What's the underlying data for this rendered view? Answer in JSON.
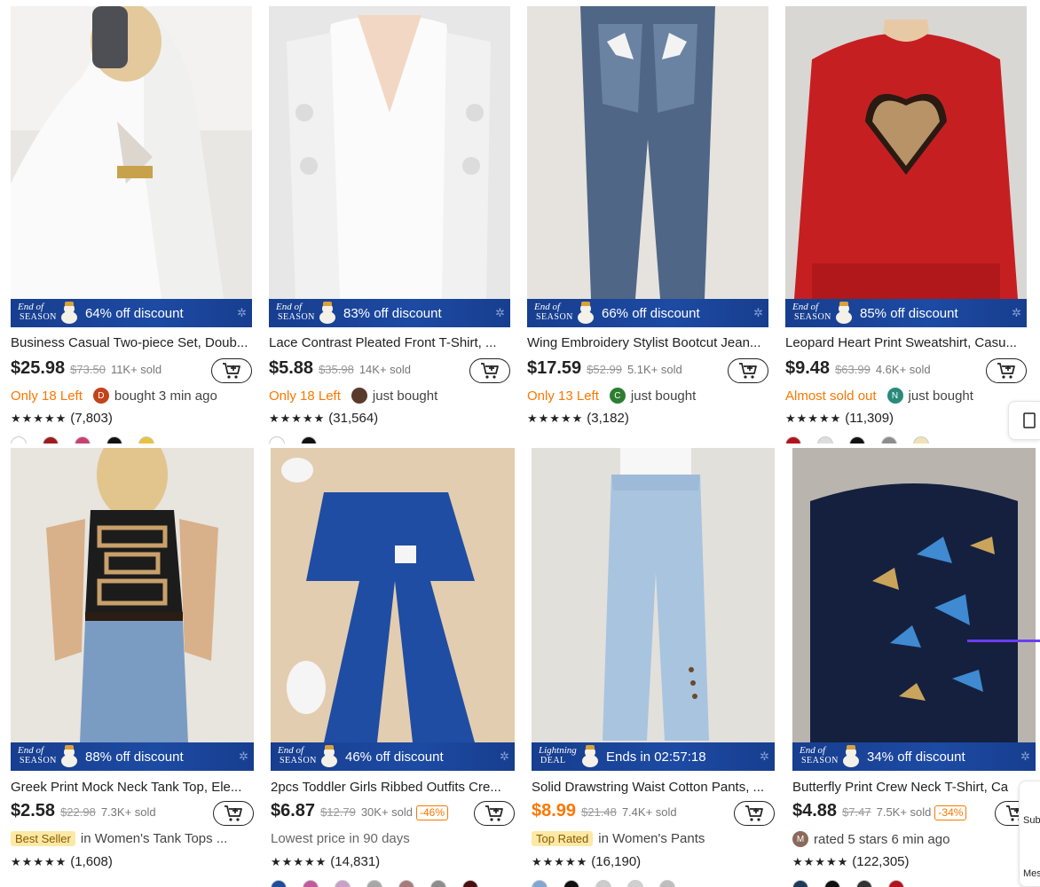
{
  "colors": {
    "accent_orange": "#fb7701",
    "banner_blue": "#1d4aa3",
    "tag_yellow": "#fde9a5",
    "side_bar_purple": "#6b3df2"
  },
  "banner_season": {
    "line1": "End of",
    "line2": "SEASON"
  },
  "banner_lightning": {
    "line1": "Lightning",
    "line2": "DEAL"
  },
  "cart_icon": "add-to-cart-icon",
  "products": [
    {
      "banner": "64% off discount",
      "title": "Business Casual Two-piece Set, Doub...",
      "price": "$25.98",
      "old_price": "$73.50",
      "sold": "11K+ sold",
      "stock": "Only 18 Left",
      "avatar_letter": "D",
      "avatar_color": "#c1441a",
      "social": "bought 3 min ago",
      "rating_stars": "★★★★★",
      "rating_count": "(7,803)",
      "swatches": [
        "#ffffff",
        "#a01b1b",
        "#c9406d",
        "#111111",
        "#e9c23b"
      ]
    },
    {
      "banner": "83% off discount",
      "title": "Lace Contrast Pleated Front T-Shirt, ...",
      "price": "$5.88",
      "old_price": "$35.98",
      "sold": "14K+ sold",
      "stock": "Only 18 Left",
      "avatar_letter": "",
      "avatar_color": "#5a3a2a",
      "social": "just bought",
      "rating_stars": "★★★★★",
      "rating_count": "(31,564)",
      "swatches": [
        "#ffffff",
        "#111111"
      ]
    },
    {
      "banner": "66% off discount",
      "title": "Wing Embroidery Stylist Bootcut Jean...",
      "price": "$17.59",
      "old_price": "$52.99",
      "sold": "5.1K+ sold",
      "stock": "Only 13 Left",
      "avatar_letter": "C",
      "avatar_color": "#2e7d32",
      "social": "just bought",
      "rating_stars": "★★★★★",
      "rating_count": "(3,182)",
      "swatches": []
    },
    {
      "banner": "85% off discount",
      "title": "Leopard Heart Print Sweatshirt, Casu...",
      "price": "$9.48",
      "old_price": "$63.99",
      "sold": "4.6K+ sold",
      "stock": "Almost sold out",
      "avatar_letter": "N",
      "avatar_color": "#2a8a7a",
      "social": "just bought",
      "rating_stars": "★★★★★",
      "rating_count": "(11,309)",
      "swatches": [
        "#b3141b",
        "#dddddd",
        "#111111",
        "#8d8d8d",
        "#f0e2b5"
      ]
    },
    {
      "banner": "88% off discount",
      "title": "Greek Print Mock Neck Tank Top, Ele...",
      "price": "$2.58",
      "old_price": "$22.98",
      "sold": "7.3K+ sold",
      "tag": "Best Seller",
      "tag_context": "in Women's Tank Tops ...",
      "rating_stars": "★★★★★",
      "rating_count": "(1,608)",
      "swatches": []
    },
    {
      "banner": "46% off discount",
      "title": "2pcs Toddler Girls Ribbed Outfits Cre...",
      "price": "$6.87",
      "old_price": "$12.79",
      "sold": "30K+ sold",
      "pct": "-46%",
      "note": "Lowest price in 90 days",
      "rating_stars": "★★★★★",
      "rating_count": "(14,831)",
      "swatches": [
        "#1d4e9b",
        "#c05a9a",
        "#c6a0c8",
        "#a7a7a7",
        "#a77b7b",
        "#8d8d8d",
        "#4a1010"
      ]
    },
    {
      "banner": "Ends in 02:57:18",
      "lightning": true,
      "title": "Solid Drawstring Waist Cotton Pants, ...",
      "price": "$8.99",
      "old_price": "$21.48",
      "sold": "7.4K+ sold",
      "orange_price": true,
      "tag": "Top Rated",
      "tag_context": "in Women's Pants",
      "rating_stars": "★★★★★",
      "rating_count": "(16,190)",
      "swatches": [
        "#7fa7d3",
        "#111111",
        "#cccccc",
        "#d0d0d0",
        "#bdbdbd"
      ]
    },
    {
      "banner": "34% off discount",
      "title": "Butterfly Print Crew Neck T-Shirt, Ca",
      "price": "$4.88",
      "old_price": "$7.47",
      "sold": "7.5K+ sold",
      "pct": "-34%",
      "avatar_letter": "M",
      "avatar_color": "#8a6a5a",
      "social": "rated 5 stars 6 min ago",
      "rating_stars": "★★★★★",
      "rating_count": "(122,305)",
      "swatches": [
        "#1d3a5a",
        "#111111",
        "#333333",
        "#b3141b"
      ]
    }
  ],
  "side": {
    "sub_label": "Sub",
    "mes_label": "Mes"
  }
}
